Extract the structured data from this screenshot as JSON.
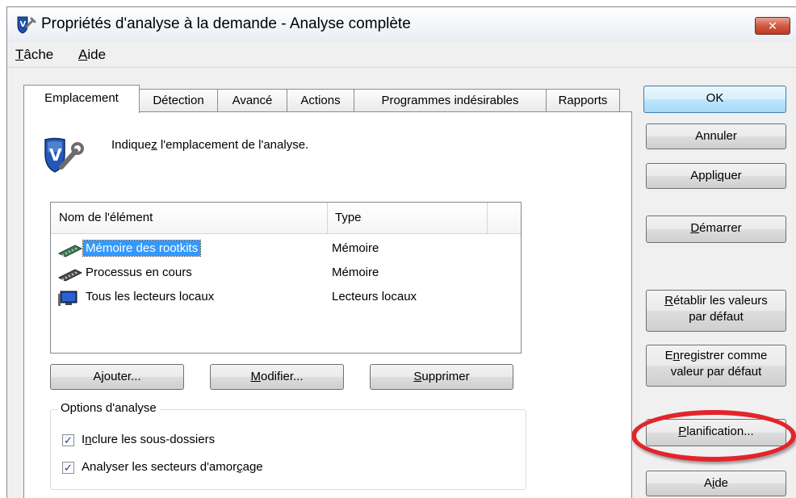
{
  "window": {
    "title": "Propriétés d'analyse à la demande - Analyse complète",
    "close_label": "✕"
  },
  "menu": [
    {
      "label": "Tâche",
      "mnemonic": "T",
      "rest": "âche"
    },
    {
      "label": "Aide",
      "mnemonic": "A",
      "rest": "ide"
    }
  ],
  "tabs": [
    "Emplacement",
    "Détection",
    "Avancé",
    "Actions",
    "Programmes indésirables",
    "Rapports"
  ],
  "active_tab": "Emplacement",
  "instruction": {
    "before": "Indique",
    "mnemonic": "z",
    "after": " l'emplacement de l'analyse."
  },
  "list": {
    "columns": [
      "Nom de l'élément",
      "Type"
    ],
    "rows": [
      {
        "name": "Mémoire des rootkits",
        "type": "Mémoire",
        "icon": "memory-chip-icon",
        "selected": true
      },
      {
        "name": "Processus en cours",
        "type": "Mémoire",
        "icon": "memory-chip-icon",
        "selected": false
      },
      {
        "name": "Tous les lecteurs locaux",
        "type": "Lecteurs locaux",
        "icon": "computer-icon",
        "selected": false
      }
    ]
  },
  "list_buttons": {
    "add": {
      "before": "A",
      "mnemonic": "j",
      "after": "outer..."
    },
    "modify": {
      "before": "",
      "mnemonic": "M",
      "after": "odifier..."
    },
    "delete": {
      "before": "",
      "mnemonic": "S",
      "after": "upprimer"
    }
  },
  "options": {
    "title": "Options d'analyse",
    "items": [
      {
        "before": "I",
        "mnemonic": "n",
        "after": "clure les sous-dossiers",
        "checked": true
      },
      {
        "before": "Analyser les secteurs d'amor",
        "mnemonic": "ç",
        "after": "age",
        "checked": true
      }
    ]
  },
  "side_buttons": {
    "ok": "OK",
    "cancel": "Annuler",
    "apply": {
      "before": "Appli",
      "mnemonic": "q",
      "after": "uer"
    },
    "start": {
      "before": "",
      "mnemonic": "D",
      "after": "émarrer"
    },
    "reset": {
      "before": "",
      "mnemonic": "R",
      "after": "établir les valeurs",
      "line2": "par défaut"
    },
    "save_default": {
      "before": "E",
      "mnemonic": "n",
      "after": "registrer comme",
      "line2": "valeur par défaut"
    },
    "schedule": {
      "before": "",
      "mnemonic": "P",
      "after": "lanification..."
    },
    "help": {
      "before": "A",
      "mnemonic": "i",
      "after": "de"
    }
  },
  "colors": {
    "selection": "#3399ff",
    "highlight_ring": "#e3242b",
    "close_button": "#c0391f"
  }
}
